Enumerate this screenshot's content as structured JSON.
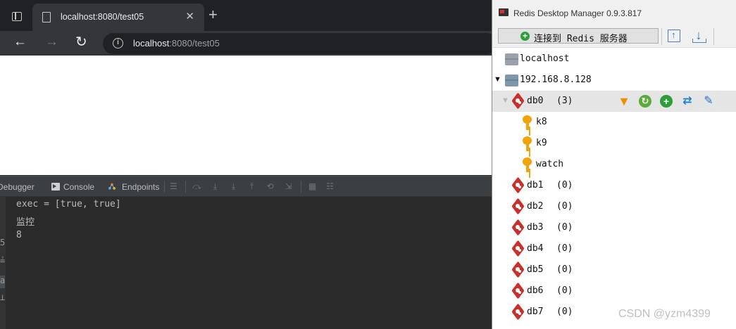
{
  "browser": {
    "tab_title": "localhost:8080/test05",
    "new_tab_glyph": "+",
    "close_glyph": "✕",
    "url_host": "localhost",
    "url_rest": ":8080/test05",
    "back_glyph": "←",
    "forward_glyph": "→",
    "reload_glyph": "↻",
    "info_glyph": "i"
  },
  "ide": {
    "tabs": {
      "debugger": "Debugger",
      "console": "Console",
      "endpoints": "Endpoints"
    },
    "toolbar_icons": [
      "menu-icon",
      "step-over-icon",
      "step-into-icon",
      "force-step-into-icon",
      "step-out-icon",
      "drop-frame-icon",
      "run-to-cursor-icon",
      "evaluate-icon",
      "trace-icon"
    ],
    "console_lines": [
      "exec = [true, true]",
      "监控",
      "8"
    ],
    "gutter_marks": [
      "5",
      "≟",
      "a",
      "⊥"
    ]
  },
  "rdm": {
    "title": "Redis Desktop Manager 0.9.3.817",
    "connect_label": "连接到 Redis 服务器",
    "connections": [
      {
        "name": "localhost"
      },
      {
        "name": "192.168.8.128"
      }
    ],
    "dbs": [
      {
        "name": "db0",
        "count": "(3)"
      },
      {
        "name": "db1",
        "count": "(0)"
      },
      {
        "name": "db2",
        "count": "(0)"
      },
      {
        "name": "db3",
        "count": "(0)"
      },
      {
        "name": "db4",
        "count": "(0)"
      },
      {
        "name": "db5",
        "count": "(0)"
      },
      {
        "name": "db6",
        "count": "(0)"
      },
      {
        "name": "db7",
        "count": "(0)"
      }
    ],
    "keys": [
      "k8",
      "k9",
      "watch"
    ],
    "expand_glyph": "▼"
  },
  "watermark": "CSDN @yzm4399",
  "colors": {
    "browser_bg": "#202124",
    "ide_bg": "#2b2b2b",
    "redis_red": "#c9302c",
    "key_gold": "#f0a30a",
    "selected_row": "#e5e5e5"
  }
}
